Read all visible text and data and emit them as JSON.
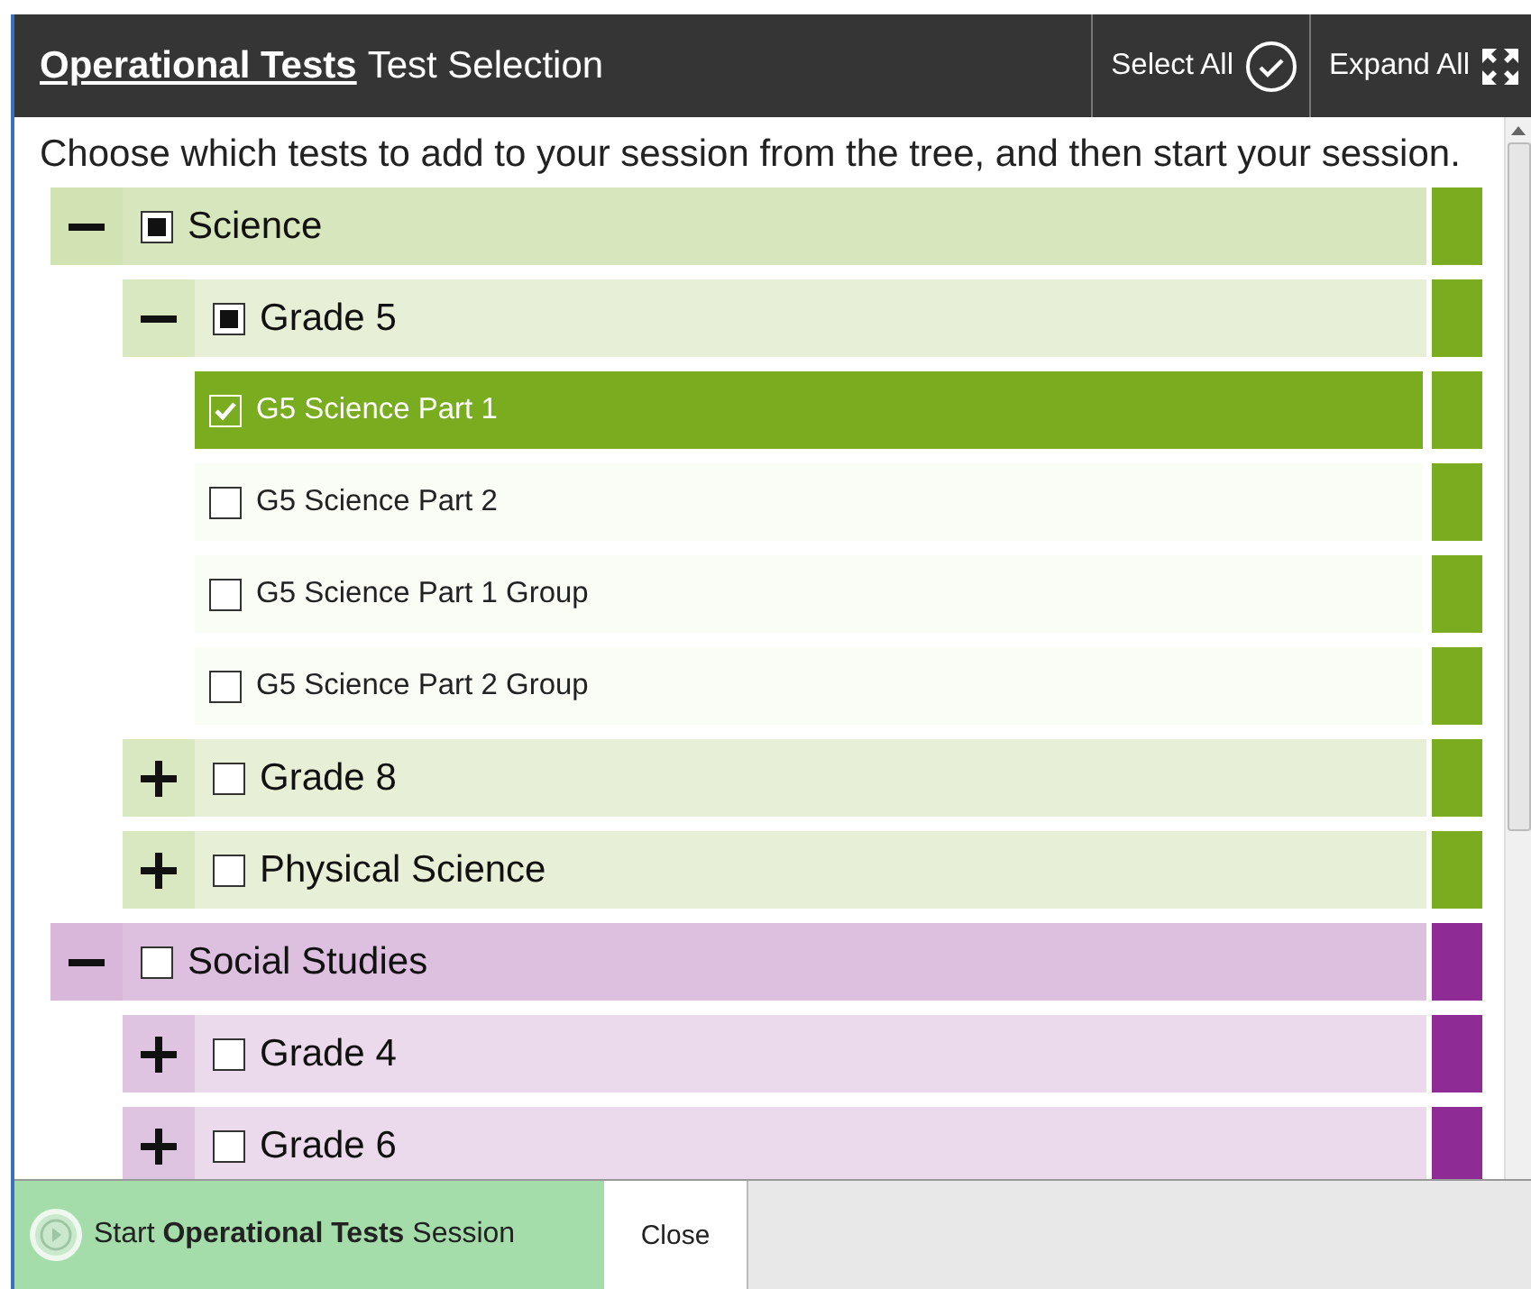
{
  "header": {
    "title_link": "Operational Tests",
    "title": "Test Selection",
    "actions": [
      {
        "kind": "select",
        "label": "Select All"
      },
      {
        "kind": "expand",
        "label": "Expand All"
      }
    ]
  },
  "instructions": "Choose which tests to add to your session from the tree, and then start your session.",
  "tree": [
    {
      "label": "Science",
      "color": "#79ad1f",
      "expanded": true,
      "checked": false,
      "partial": true,
      "children": [
        {
          "label": "Grade 5",
          "expanded": true,
          "checked": false,
          "partial": true,
          "children": [
            {
              "label": "G5 Science Part 1",
              "checked": true
            },
            {
              "label": "G5 Science Part 2",
              "checked": false
            },
            {
              "label": "G5 Science Part 1 Group",
              "checked": false
            },
            {
              "label": "G5 Science Part 2 Group",
              "checked": false
            }
          ]
        },
        {
          "label": "Grade 8",
          "expanded": false,
          "checked": false,
          "partial": false
        },
        {
          "label": "Physical Science",
          "expanded": false,
          "checked": false,
          "partial": false
        }
      ]
    },
    {
      "label": "Social Studies",
      "color": "#8e2b95",
      "expanded": true,
      "checked": false,
      "partial": false,
      "children": [
        {
          "label": "Grade 4",
          "expanded": false,
          "checked": false,
          "partial": false
        },
        {
          "label": "Grade 6",
          "expanded": false,
          "checked": false,
          "partial": false
        }
      ]
    }
  ],
  "footer": {
    "start": "Start **Operational Tests** Session",
    "close": "Close"
  }
}
